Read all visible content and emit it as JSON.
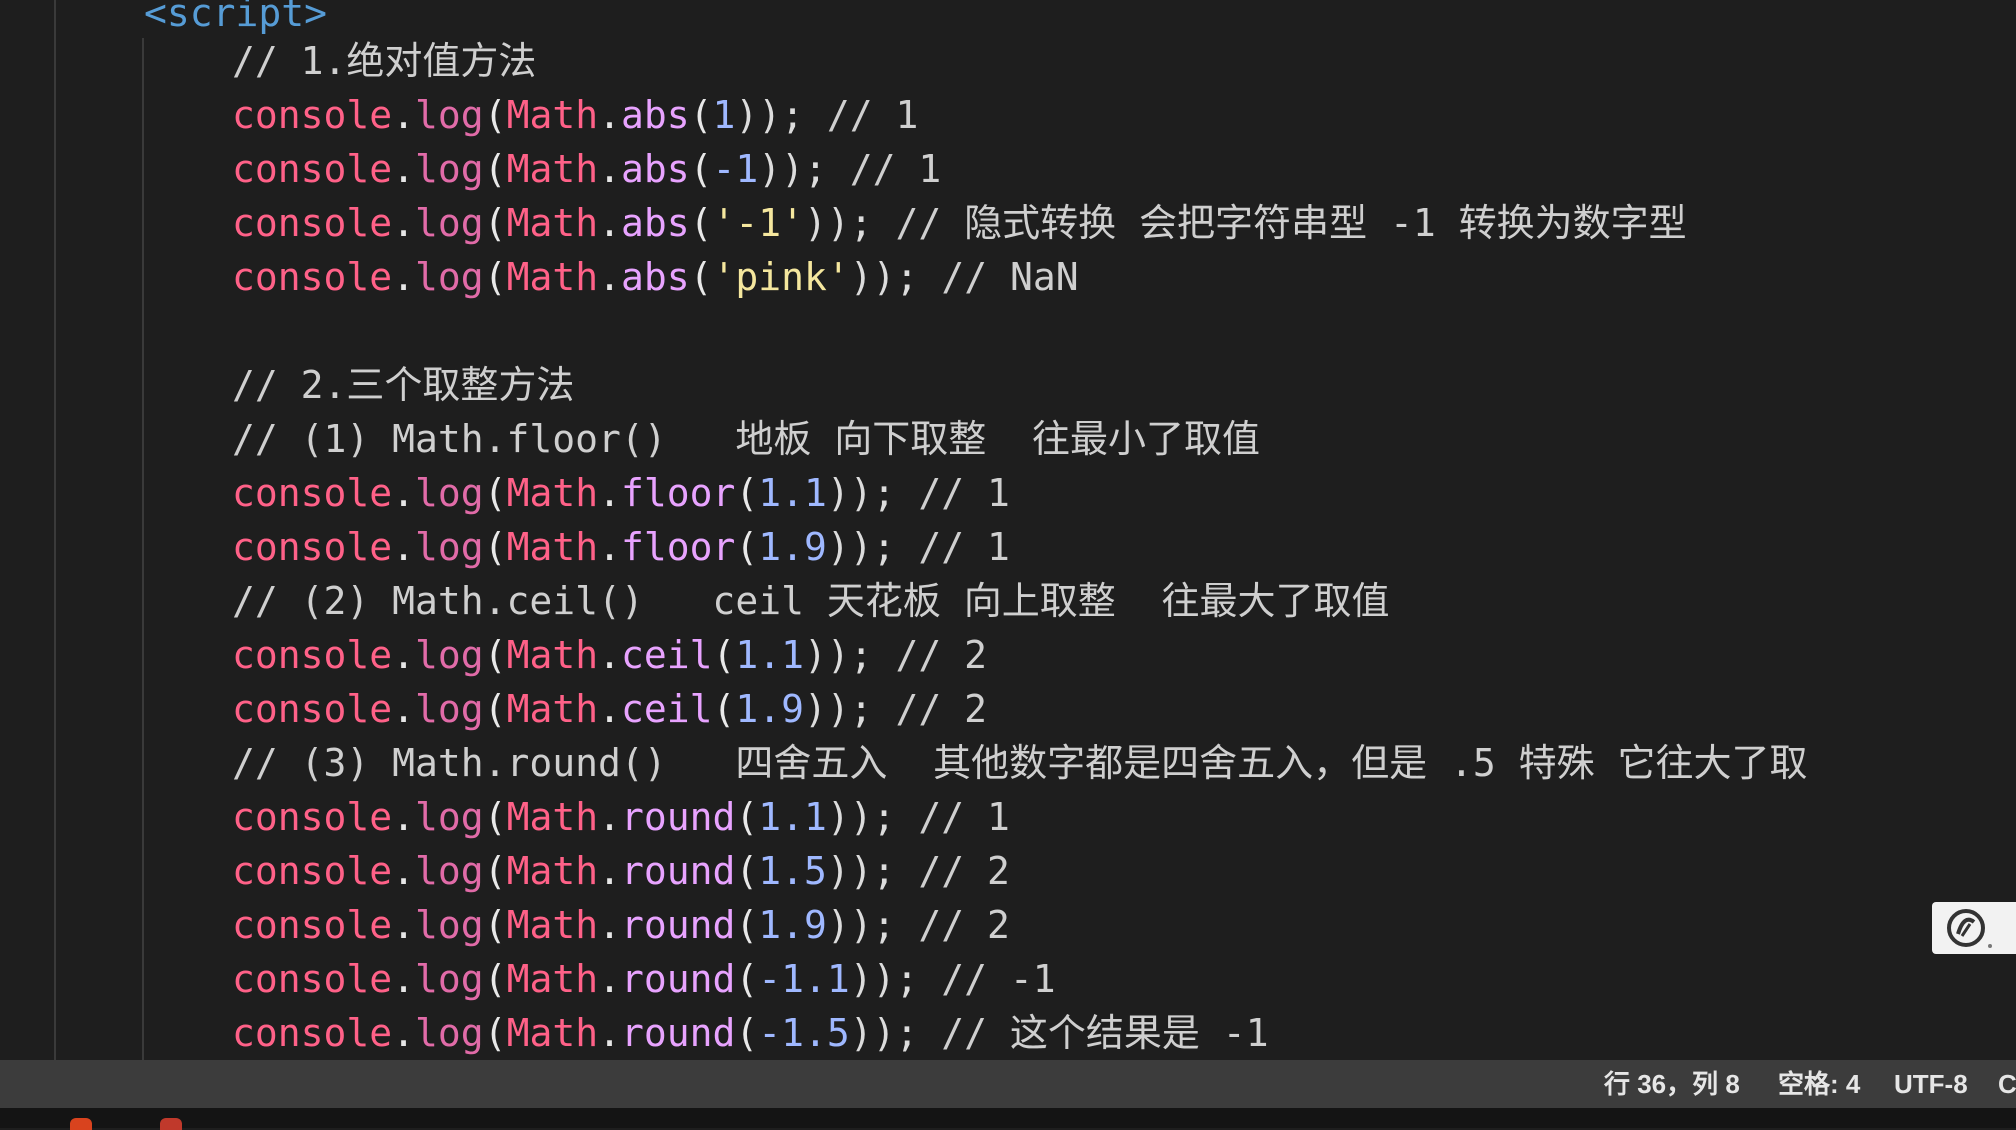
{
  "editor": {
    "lines": [
      [
        {
          "t": "<script>",
          "c": "tag"
        }
      ],
      [
        {
          "t": "// 1.绝对值方法",
          "c": "comment"
        }
      ],
      [
        {
          "t": "console",
          "c": "console"
        },
        {
          "t": ".",
          "c": "dot"
        },
        {
          "t": "log",
          "c": "fn"
        },
        {
          "t": "(",
          "c": "paren"
        },
        {
          "t": "Math",
          "c": "math"
        },
        {
          "t": ".",
          "c": "dot"
        },
        {
          "t": "abs",
          "c": "method"
        },
        {
          "t": "(",
          "c": "paren"
        },
        {
          "t": "1",
          "c": "num"
        },
        {
          "t": "));",
          "c": "punc"
        },
        {
          "t": " // 1",
          "c": "comment"
        }
      ],
      [
        {
          "t": "console",
          "c": "console"
        },
        {
          "t": ".",
          "c": "dot"
        },
        {
          "t": "log",
          "c": "fn"
        },
        {
          "t": "(",
          "c": "paren"
        },
        {
          "t": "Math",
          "c": "math"
        },
        {
          "t": ".",
          "c": "dot"
        },
        {
          "t": "abs",
          "c": "method"
        },
        {
          "t": "(",
          "c": "paren"
        },
        {
          "t": "-1",
          "c": "num"
        },
        {
          "t": "));",
          "c": "punc"
        },
        {
          "t": " // 1",
          "c": "comment"
        }
      ],
      [
        {
          "t": "console",
          "c": "console"
        },
        {
          "t": ".",
          "c": "dot"
        },
        {
          "t": "log",
          "c": "fn"
        },
        {
          "t": "(",
          "c": "paren"
        },
        {
          "t": "Math",
          "c": "math"
        },
        {
          "t": ".",
          "c": "dot"
        },
        {
          "t": "abs",
          "c": "method"
        },
        {
          "t": "(",
          "c": "paren"
        },
        {
          "t": "'-1'",
          "c": "str"
        },
        {
          "t": "));",
          "c": "punc"
        },
        {
          "t": " // 隐式转换 会把字符串型 -1 转换为数字型",
          "c": "comment"
        }
      ],
      [
        {
          "t": "console",
          "c": "console"
        },
        {
          "t": ".",
          "c": "dot"
        },
        {
          "t": "log",
          "c": "fn"
        },
        {
          "t": "(",
          "c": "paren"
        },
        {
          "t": "Math",
          "c": "math"
        },
        {
          "t": ".",
          "c": "dot"
        },
        {
          "t": "abs",
          "c": "method"
        },
        {
          "t": "(",
          "c": "paren"
        },
        {
          "t": "'pink'",
          "c": "str"
        },
        {
          "t": "));",
          "c": "punc"
        },
        {
          "t": " // NaN",
          "c": "comment"
        }
      ],
      [],
      [
        {
          "t": "// 2.三个取整方法",
          "c": "comment"
        }
      ],
      [
        {
          "t": "// (1) Math.floor()   地板 向下取整  往最小了取值",
          "c": "comment"
        }
      ],
      [
        {
          "t": "console",
          "c": "console"
        },
        {
          "t": ".",
          "c": "dot"
        },
        {
          "t": "log",
          "c": "fn"
        },
        {
          "t": "(",
          "c": "paren"
        },
        {
          "t": "Math",
          "c": "math"
        },
        {
          "t": ".",
          "c": "dot"
        },
        {
          "t": "floor",
          "c": "method"
        },
        {
          "t": "(",
          "c": "paren"
        },
        {
          "t": "1.1",
          "c": "num"
        },
        {
          "t": "));",
          "c": "punc"
        },
        {
          "t": " // 1",
          "c": "comment"
        }
      ],
      [
        {
          "t": "console",
          "c": "console"
        },
        {
          "t": ".",
          "c": "dot"
        },
        {
          "t": "log",
          "c": "fn"
        },
        {
          "t": "(",
          "c": "paren"
        },
        {
          "t": "Math",
          "c": "math"
        },
        {
          "t": ".",
          "c": "dot"
        },
        {
          "t": "floor",
          "c": "method"
        },
        {
          "t": "(",
          "c": "paren"
        },
        {
          "t": "1.9",
          "c": "num"
        },
        {
          "t": "));",
          "c": "punc"
        },
        {
          "t": " // 1",
          "c": "comment"
        }
      ],
      [
        {
          "t": "// (2) Math.ceil()   ceil 天花板 向上取整  往最大了取值",
          "c": "comment"
        }
      ],
      [
        {
          "t": "console",
          "c": "console"
        },
        {
          "t": ".",
          "c": "dot"
        },
        {
          "t": "log",
          "c": "fn"
        },
        {
          "t": "(",
          "c": "paren"
        },
        {
          "t": "Math",
          "c": "math"
        },
        {
          "t": ".",
          "c": "dot"
        },
        {
          "t": "ceil",
          "c": "method"
        },
        {
          "t": "(",
          "c": "paren"
        },
        {
          "t": "1.1",
          "c": "num"
        },
        {
          "t": "));",
          "c": "punc"
        },
        {
          "t": " // 2",
          "c": "comment"
        }
      ],
      [
        {
          "t": "console",
          "c": "console"
        },
        {
          "t": ".",
          "c": "dot"
        },
        {
          "t": "log",
          "c": "fn"
        },
        {
          "t": "(",
          "c": "paren"
        },
        {
          "t": "Math",
          "c": "math"
        },
        {
          "t": ".",
          "c": "dot"
        },
        {
          "t": "ceil",
          "c": "method"
        },
        {
          "t": "(",
          "c": "paren"
        },
        {
          "t": "1.9",
          "c": "num"
        },
        {
          "t": "));",
          "c": "punc"
        },
        {
          "t": " // 2",
          "c": "comment"
        }
      ],
      [
        {
          "t": "// (3) Math.round()   四舍五入  其他数字都是四舍五入，但是 .5 特殊 它往大了取",
          "c": "comment"
        }
      ],
      [
        {
          "t": "console",
          "c": "console"
        },
        {
          "t": ".",
          "c": "dot"
        },
        {
          "t": "log",
          "c": "fn"
        },
        {
          "t": "(",
          "c": "paren"
        },
        {
          "t": "Math",
          "c": "math"
        },
        {
          "t": ".",
          "c": "dot"
        },
        {
          "t": "round",
          "c": "method"
        },
        {
          "t": "(",
          "c": "paren"
        },
        {
          "t": "1.1",
          "c": "num"
        },
        {
          "t": "));",
          "c": "punc"
        },
        {
          "t": " // 1",
          "c": "comment"
        }
      ],
      [
        {
          "t": "console",
          "c": "console"
        },
        {
          "t": ".",
          "c": "dot"
        },
        {
          "t": "log",
          "c": "fn"
        },
        {
          "t": "(",
          "c": "paren"
        },
        {
          "t": "Math",
          "c": "math"
        },
        {
          "t": ".",
          "c": "dot"
        },
        {
          "t": "round",
          "c": "method"
        },
        {
          "t": "(",
          "c": "paren"
        },
        {
          "t": "1.5",
          "c": "num"
        },
        {
          "t": "));",
          "c": "punc"
        },
        {
          "t": " // 2",
          "c": "comment"
        }
      ],
      [
        {
          "t": "console",
          "c": "console"
        },
        {
          "t": ".",
          "c": "dot"
        },
        {
          "t": "log",
          "c": "fn"
        },
        {
          "t": "(",
          "c": "paren"
        },
        {
          "t": "Math",
          "c": "math"
        },
        {
          "t": ".",
          "c": "dot"
        },
        {
          "t": "round",
          "c": "method"
        },
        {
          "t": "(",
          "c": "paren"
        },
        {
          "t": "1.9",
          "c": "num"
        },
        {
          "t": "));",
          "c": "punc"
        },
        {
          "t": " // 2",
          "c": "comment"
        }
      ],
      [
        {
          "t": "console",
          "c": "console"
        },
        {
          "t": ".",
          "c": "dot"
        },
        {
          "t": "log",
          "c": "fn"
        },
        {
          "t": "(",
          "c": "paren"
        },
        {
          "t": "Math",
          "c": "math"
        },
        {
          "t": ".",
          "c": "dot"
        },
        {
          "t": "round",
          "c": "method"
        },
        {
          "t": "(",
          "c": "paren"
        },
        {
          "t": "-1.1",
          "c": "num"
        },
        {
          "t": "));",
          "c": "punc"
        },
        {
          "t": " // -1",
          "c": "comment"
        }
      ],
      [
        {
          "t": "console",
          "c": "console"
        },
        {
          "t": ".",
          "c": "dot"
        },
        {
          "t": "log",
          "c": "fn"
        },
        {
          "t": "(",
          "c": "paren"
        },
        {
          "t": "Math",
          "c": "math"
        },
        {
          "t": ".",
          "c": "dot"
        },
        {
          "t": "round",
          "c": "method"
        },
        {
          "t": "(",
          "c": "paren"
        },
        {
          "t": "-1.5",
          "c": "num"
        },
        {
          "t": "));",
          "c": "punc"
        },
        {
          "t": " // 这个结果是 -1",
          "c": "comment"
        }
      ]
    ]
  },
  "status_bar": {
    "cursor_position": "行 36，列 8",
    "indentation": "空格: 4",
    "encoding": "UTF-8",
    "line_ending": "C"
  },
  "overlay": {
    "badge_icon": "recorder-logo-icon"
  },
  "colors": {
    "editor_bg": "#1e1e1e",
    "status_bg": "#3c3c3c",
    "keyword_pink": "#ff6188",
    "number_blue": "#9fb8ff",
    "string_yellow": "#f5e79e",
    "tag_blue": "#569cd6"
  }
}
